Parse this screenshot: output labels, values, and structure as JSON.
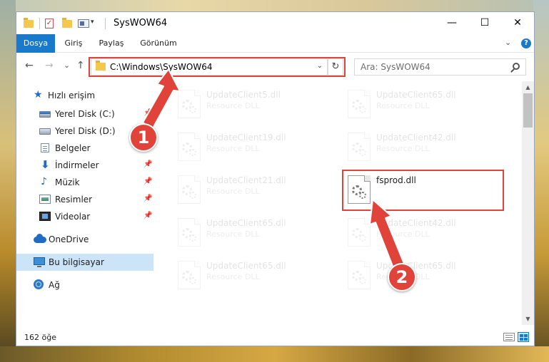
{
  "window": {
    "title": "SysWOW64",
    "minimize_label": "—",
    "maximize_label": "☐",
    "close_label": "✕"
  },
  "quick_access_toolbar": {
    "check_glyph": "✓",
    "dropdown_glyph": "▾"
  },
  "ribbon": {
    "tabs": [
      "Dosya",
      "Giriş",
      "Paylaş",
      "Görünüm"
    ],
    "expand_glyph": "⌄",
    "help_label": "?"
  },
  "navigation": {
    "back_glyph": "←",
    "forward_glyph": "→",
    "recent_glyph": "⌄",
    "up_glyph": "↑"
  },
  "address_bar": {
    "path": "C:\\Windows\\SysWOW64",
    "dropdown_glyph": "⌄",
    "refresh_glyph": "↻"
  },
  "search": {
    "placeholder": "Ara: SysWOW64"
  },
  "sidebar": {
    "items": [
      {
        "label": "Hızlı erişim",
        "icon": "star-icon"
      },
      {
        "label": "Yerel Disk (C:)",
        "icon": "drive-icon",
        "pinned": true
      },
      {
        "label": "Yerel Disk (D:)",
        "icon": "drive-icon"
      },
      {
        "label": "Belgeler",
        "icon": "documents-icon",
        "pinned": true
      },
      {
        "label": "İndirmeler",
        "icon": "download-icon",
        "pinned": true
      },
      {
        "label": "Müzik",
        "icon": "music-icon",
        "pinned": true
      },
      {
        "label": "Resimler",
        "icon": "pictures-icon",
        "pinned": true
      },
      {
        "label": "Videolar",
        "icon": "videos-icon",
        "pinned": true
      },
      {
        "label": "OneDrive",
        "icon": "cloud-icon"
      },
      {
        "label": "Bu bilgisayar",
        "icon": "computer-icon",
        "selected": true
      },
      {
        "label": "Ağ",
        "icon": "network-icon"
      }
    ],
    "pin_glyph": "📌"
  },
  "files": [
    {
      "name": "UpdateClient5.dll",
      "type": "Resource DLL",
      "faded": true
    },
    {
      "name": "UpdateClient65.dll",
      "type": "Resource DLL",
      "faded": true
    },
    {
      "name": "UpdateClient19.dll",
      "type": "Resource DLL",
      "faded": true
    },
    {
      "name": "UpdateClient42.dll",
      "type": "Resource DLL",
      "faded": true
    },
    {
      "name": "UpdateClient21.dll",
      "type": "Resource DLL",
      "faded": true
    },
    {
      "name": "fsprod.dll",
      "type": "",
      "faded": false
    },
    {
      "name": "UpdateClient65.dll",
      "type": "Resource DLL",
      "faded": true
    },
    {
      "name": "UpdateClient42.dll",
      "type": "Resource DLL",
      "faded": true
    },
    {
      "name": "UpdateClient65.dll",
      "type": "Resource DLL",
      "faded": true
    },
    {
      "name": "UpdateClient65.dll",
      "type": "Resource DLL",
      "faded": true
    }
  ],
  "scrollbar": {
    "up_glyph": "▲",
    "down_glyph": "▼"
  },
  "status": {
    "item_count": "162 öğe"
  },
  "annotations": {
    "step1_label": "1",
    "step2_label": "2",
    "color": "#e0433a"
  }
}
